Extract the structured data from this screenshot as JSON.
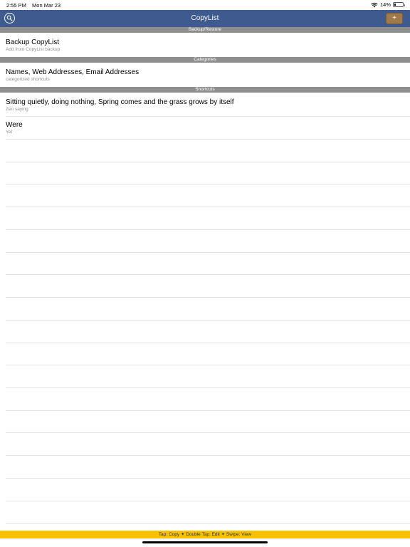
{
  "status_bar": {
    "time": "2:55 PM",
    "date": "Mon Mar 23",
    "battery": "14%",
    "battery_level": 0.14
  },
  "nav": {
    "title": "CopyList",
    "add_label": "+"
  },
  "sections": {
    "backup": {
      "header": "Backup/Restore",
      "rows": [
        {
          "title": "Backup CopyList",
          "subtitle": "Add from CopyList backup"
        }
      ]
    },
    "categories": {
      "header": "Categories",
      "rows": [
        {
          "title": "Names, Web Addresses, Email Addresses",
          "subtitle": "categorized shortcuts"
        }
      ]
    },
    "shortcuts": {
      "header": "Shortcuts",
      "rows": [
        {
          "title": "Sitting quietly, doing nothing, Spring comes and the grass grows by itself",
          "subtitle": "Zen saying"
        },
        {
          "title": "Were",
          "subtitle": "Yet"
        }
      ]
    }
  },
  "footer": {
    "hint": "Tap: Copy ✦ Double Tap: Edit ✦ Swipe: View"
  },
  "colors": {
    "nav_background": "#3e5a8e",
    "section_header": "#8e8e8e",
    "footer_background": "#f7c100",
    "add_button": "#a07a4a"
  }
}
